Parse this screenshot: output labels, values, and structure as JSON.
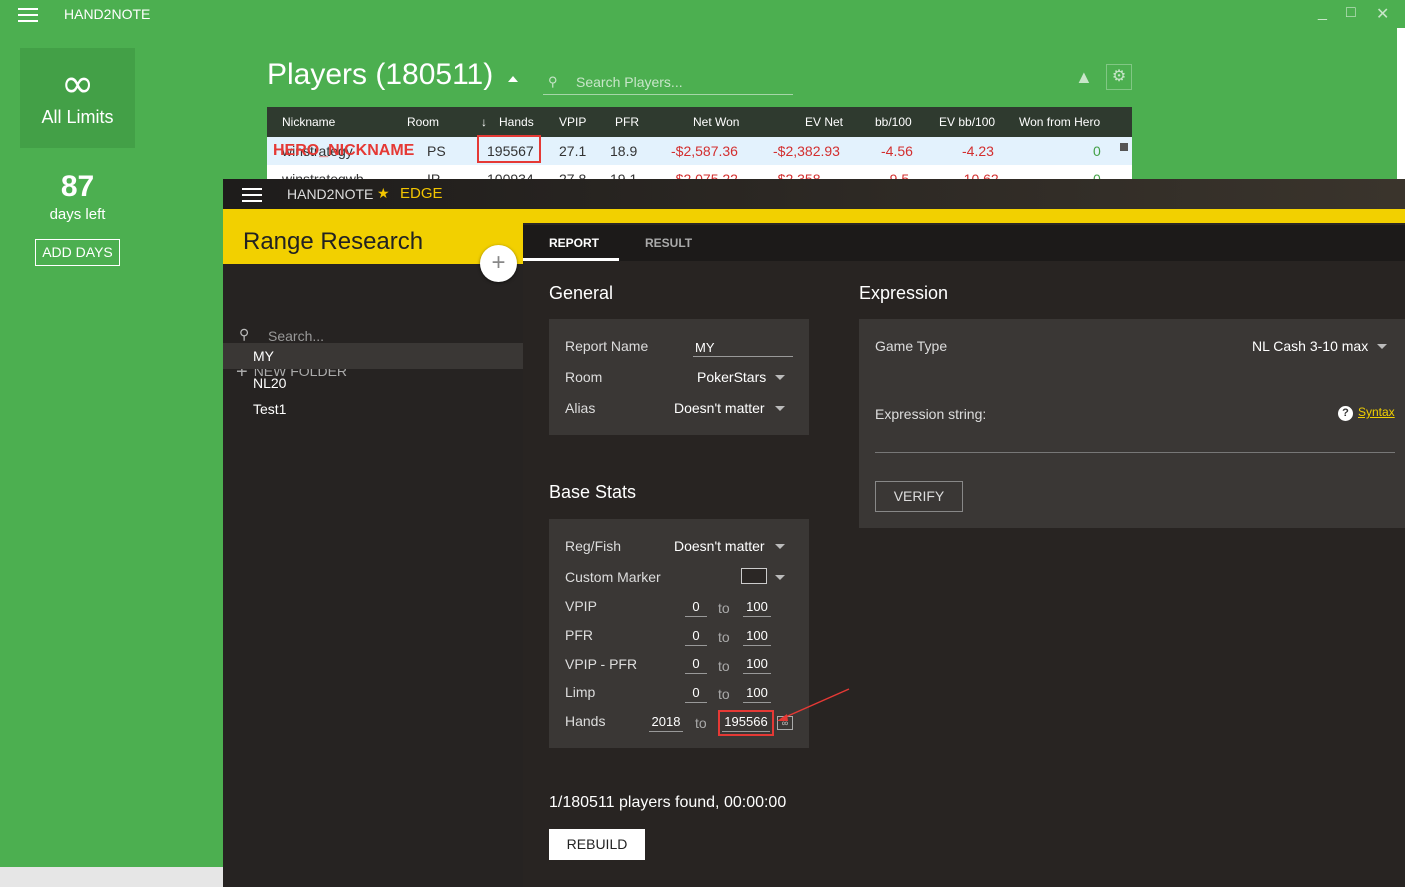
{
  "bg": {
    "app_title": "HAND2NOTE",
    "limits_icon": "∞",
    "limits_label": "All Limits",
    "days_number": "87",
    "days_label": "days left",
    "add_days_label": "ADD DAYS",
    "players_title": "Players (180511)",
    "search_placeholder": "Search Players...",
    "hero_label": "HERO_NICKNAME",
    "table": {
      "headers": [
        "Nickname",
        "Room",
        "Hands",
        "VPIP",
        "PFR",
        "Net Won",
        "EV Net",
        "bb/100",
        "EV bb/100",
        "Won from Hero"
      ],
      "row1": {
        "nickname": "winstrategy",
        "room": "PS",
        "hands": "195567",
        "vpip": "27.1",
        "pfr": "18.9",
        "net_won": "-$2,587.36",
        "ev_net": "-$2,382.93",
        "bb100": "-4.56",
        "ev_bb100": "-4.23",
        "won_from_hero": "0"
      },
      "row2": {
        "nickname": "winstrategwb",
        "room": "IP",
        "hands": "100934",
        "vpip": "27.8",
        "pfr": "19.1",
        "net_won": "-$2,075.22",
        "ev_net": "-$2,358",
        "bb100": "-9.5",
        "ev_bb100": "-10.62",
        "won_from_hero": "0"
      }
    }
  },
  "edge": {
    "app_title": "HAND2NOTE",
    "edition": "EDGE",
    "sidebar": {
      "title": "Range Research",
      "add_icon": "+",
      "search_placeholder": "Search...",
      "new_folder_label": "NEW FOLDER",
      "folders": [
        "MY",
        "NL20",
        "Test1"
      ]
    },
    "tabs": [
      "REPORT",
      "RESULT"
    ],
    "general": {
      "title": "General",
      "report_name_label": "Report Name",
      "report_name_value": "MY",
      "room_label": "Room",
      "room_value": "PokerStars",
      "alias_label": "Alias",
      "alias_value": "Doesn't matter"
    },
    "expression": {
      "title": "Expression",
      "game_type_label": "Game Type",
      "game_type_value": "NL Cash 3-10 max",
      "expr_label": "Expression string:",
      "syntax_label": "Syntax",
      "verify_label": "VERIFY"
    },
    "base_stats": {
      "title": "Base Stats",
      "regfish_label": "Reg/Fish",
      "regfish_value": "Doesn't matter",
      "marker_label": "Custom Marker",
      "to_label": "to",
      "rows": [
        {
          "label": "VPIP",
          "from": "0",
          "to": "100"
        },
        {
          "label": "PFR",
          "from": "0",
          "to": "100"
        },
        {
          "label": "VPIP - PFR",
          "from": "0",
          "to": "100"
        },
        {
          "label": "Limp",
          "from": "0",
          "to": "100"
        },
        {
          "label": "Hands",
          "from": "2018",
          "to": "195566"
        }
      ],
      "infinity_icon": "∞"
    },
    "found_text": "1/180511 players found, 00:00:00",
    "rebuild_label": "REBUILD"
  },
  "colors": {
    "green_bg": "#4caf50",
    "edge_yellow": "#f2d000",
    "annotation_red": "#e53935"
  }
}
